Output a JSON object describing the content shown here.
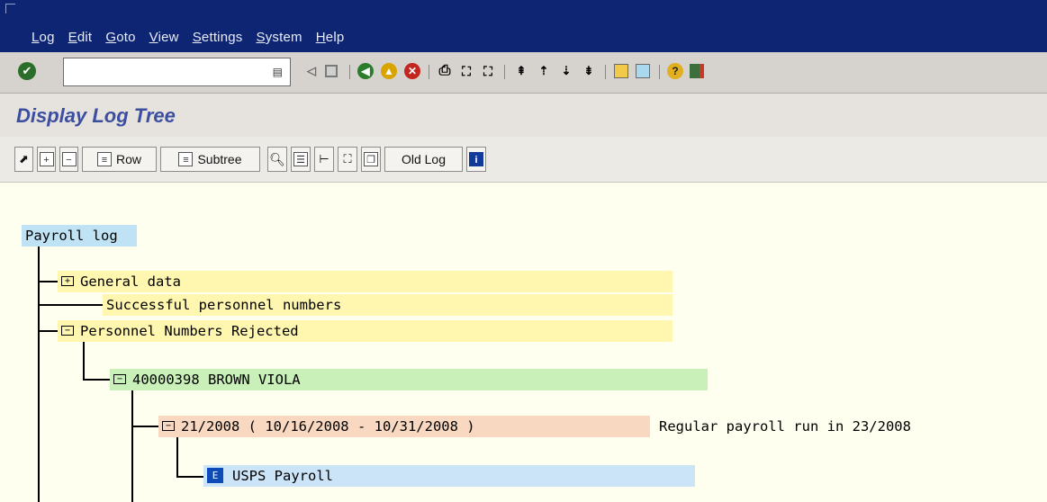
{
  "menubar": {
    "items": [
      {
        "label": "Log",
        "u": "L",
        "rest": "og"
      },
      {
        "label": "Edit",
        "u": "E",
        "rest": "dit"
      },
      {
        "label": "Goto",
        "u": "G",
        "rest": "oto"
      },
      {
        "label": "View",
        "u": "V",
        "rest": "iew"
      },
      {
        "label": "Settings",
        "u": "S",
        "rest": "ettings"
      },
      {
        "label": "System",
        "u": "S",
        "rest": "ystem"
      },
      {
        "label": "Help",
        "u": "H",
        "rest": "elp"
      }
    ]
  },
  "toolbar": {
    "command_value": "",
    "icons": [
      "enter-icon",
      "back-icon",
      "save-icon",
      "back-nav-icon",
      "exit-icon",
      "cancel-icon",
      "print-icon",
      "find-icon",
      "find-next-icon",
      "first-page-icon",
      "previous-page-icon",
      "next-page-icon",
      "last-page-icon",
      "create-session-icon",
      "shortcut-icon",
      "help-icon",
      "layout-menu-icon"
    ]
  },
  "title": "Display Log Tree",
  "app_toolbar": {
    "row_label": "Row",
    "subtree_label": "Subtree",
    "old_log_label": "Old Log"
  },
  "tree": {
    "root": "Payroll log",
    "general_data": "General data",
    "successful": "Successful personnel numbers",
    "rejected": "Personnel Numbers Rejected",
    "employee": "40000398 BROWN VIOLA",
    "period": "21/2008 ( 10/16/2008 - 10/31/2008 )",
    "period_note": "Regular payroll run in 23/2008",
    "leaf": "USPS Payroll",
    "leaf_icon_letter": "E"
  },
  "colors": {
    "menubar_bg": "#0d2572",
    "root_highlight": "#bfe3f4",
    "yellow_node": "#fff7b0",
    "green_node": "#c8f0b8",
    "salmon_node": "#f8d8c0",
    "blue_node": "#cce4f8"
  }
}
